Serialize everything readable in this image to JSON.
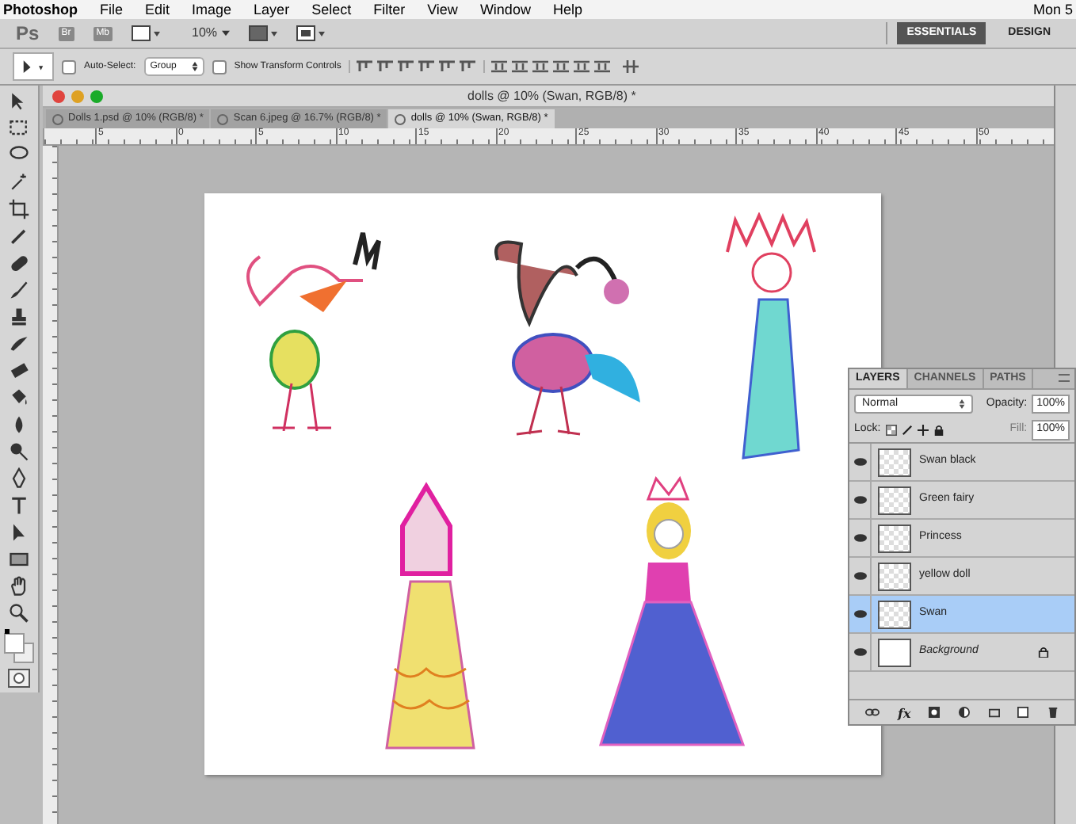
{
  "menu_bar": {
    "items": [
      "Photoshop",
      "File",
      "Edit",
      "Image",
      "Layer",
      "Select",
      "Filter",
      "View",
      "Window",
      "Help"
    ],
    "clock": "Mon 5"
  },
  "app_bar": {
    "logo": "Ps",
    "bridge": "Br",
    "mini_bridge": "Mb",
    "zoom": "10%",
    "workspaces": [
      {
        "label": "ESSENTIALS",
        "selected": true
      },
      {
        "label": "DESIGN",
        "selected": false
      }
    ]
  },
  "options_bar": {
    "auto_select": {
      "label": "Auto-Select:",
      "checked": false
    },
    "auto_select_target": "Group",
    "show_transform": {
      "label": "Show Transform Controls",
      "checked": false
    }
  },
  "document": {
    "title": "dolls @ 10% (Swan, RGB/8) *",
    "tabs": [
      {
        "label": "Dolls 1.psd @ 10% (RGB/8) *",
        "selected": false
      },
      {
        "label": "Scan 6.jpeg @ 16.7% (RGB/8) *",
        "selected": false
      },
      {
        "label": "dolls @ 10% (Swan, RGB/8) *",
        "selected": true
      }
    ],
    "ruler_labels": [
      "5",
      "0",
      "5",
      "10",
      "15",
      "20",
      "25",
      "30",
      "35",
      "40",
      "45",
      "50"
    ]
  },
  "layers_panel": {
    "tabs": [
      {
        "label": "LAYERS",
        "selected": true
      },
      {
        "label": "CHANNELS",
        "selected": false
      },
      {
        "label": "PATHS",
        "selected": false
      }
    ],
    "blend_mode": "Normal",
    "opacity_label": "Opacity:",
    "opacity": "100%",
    "lock_label": "Lock:",
    "fill_label": "Fill:",
    "fill": "100%",
    "layers": [
      {
        "name": "Swan black",
        "visible": true,
        "selected": false,
        "kind": "layer",
        "locked": false
      },
      {
        "name": "Green fairy",
        "visible": true,
        "selected": false,
        "kind": "layer",
        "locked": false
      },
      {
        "name": "Princess",
        "visible": true,
        "selected": false,
        "kind": "layer",
        "locked": false
      },
      {
        "name": "yellow doll",
        "visible": true,
        "selected": false,
        "kind": "layer",
        "locked": false
      },
      {
        "name": "Swan",
        "visible": true,
        "selected": true,
        "kind": "layer",
        "locked": false
      },
      {
        "name": "Background",
        "visible": true,
        "selected": false,
        "kind": "background",
        "locked": true
      }
    ],
    "footer_fx": "fx"
  }
}
